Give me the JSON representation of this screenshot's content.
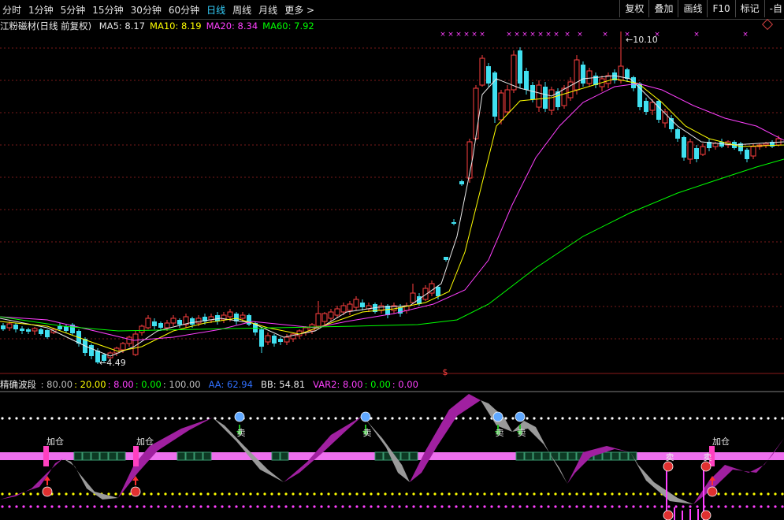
{
  "toolbar": {
    "tabs": [
      "分时",
      "1分钟",
      "5分钟",
      "15分钟",
      "30分钟",
      "60分钟",
      "日线",
      "周线",
      "月线",
      "更多 >"
    ],
    "active_tab": "日线",
    "right_buttons": [
      "复权",
      "叠加",
      "画线",
      "F10",
      "标记",
      "-自"
    ]
  },
  "main_panel": {
    "title": "江粉磁材(日线 前复权)",
    "ma": [
      {
        "label": "MA5: 8.17",
        "color": "#e8e8e8"
      },
      {
        "label": "MA10: 8.19",
        "color": "#ffff00"
      },
      {
        "label": "MA20: 8.34",
        "color": "#ff40ff"
      },
      {
        "label": "MA60: 7.92",
        "color": "#00ff00"
      }
    ],
    "high_label": "10.10",
    "low_label": "4.49",
    "dollar_marker": "$"
  },
  "sub_panel": {
    "title": "精确波段",
    "values": [
      {
        "label": ": 80.00",
        "color": "#c0c0c0"
      },
      {
        "label": ": 20.00",
        "color": "#ffff00"
      },
      {
        "label": ": 8.00",
        "color": "#ff40ff"
      },
      {
        "label": ": 0.00",
        "color": "#00ff00"
      },
      {
        "label": ": 100.00",
        "color": "#c0c0c0"
      },
      {
        "label": "AA: 62.94",
        "color": "#3070ff"
      },
      {
        "label": "BB: 54.81",
        "color": "#e8e8e8"
      },
      {
        "label": "VAR2: 8.00",
        "color": "#ff40ff"
      },
      {
        "label": ": 0.00",
        "color": "#00ff00"
      },
      {
        "label": ": 0.00",
        "color": "#ff40ff"
      }
    ],
    "add_label": "加仓",
    "sell_label": "卖"
  },
  "colors": {
    "up": "#ff4040",
    "down": "#40e0f0",
    "ma5": "#e8e8e8",
    "ma10": "#ffff00",
    "ma20": "#ff40ff",
    "ma60": "#00ff00"
  }
}
